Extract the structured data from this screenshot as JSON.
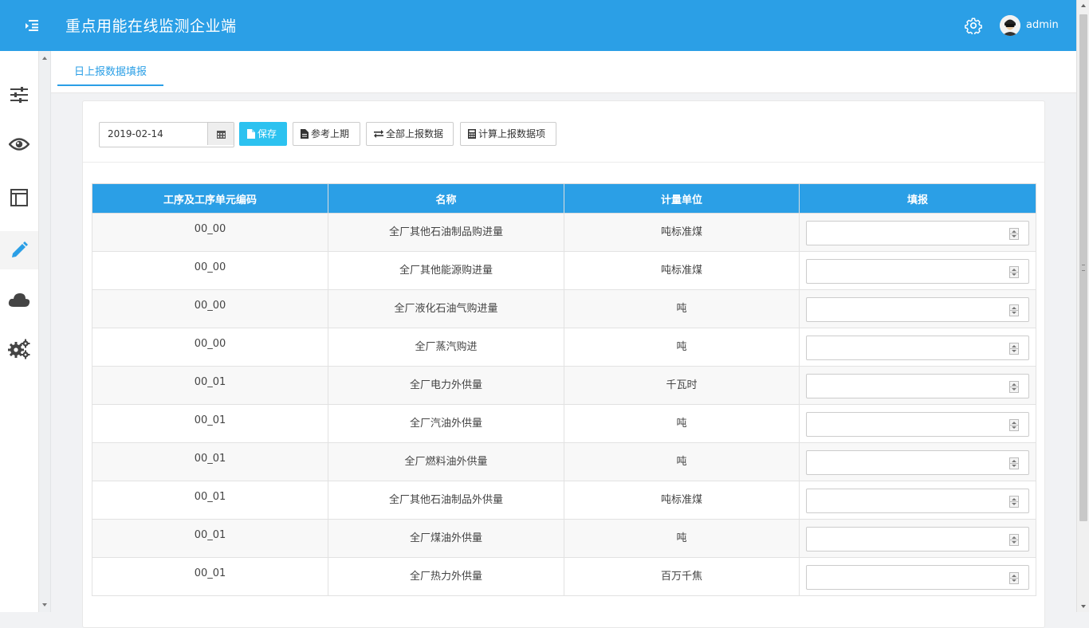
{
  "header": {
    "app_title": "重点用能在线监测企业端",
    "user_name": "admin"
  },
  "sidebar": {
    "items": [
      {
        "icon": "sliders-icon"
      },
      {
        "icon": "eye-icon"
      },
      {
        "icon": "layout-icon"
      },
      {
        "icon": "pencil-icon",
        "active": true
      },
      {
        "icon": "cloud-icon"
      },
      {
        "icon": "gears-icon"
      }
    ]
  },
  "tabs": [
    {
      "label": "日上报数据填报",
      "active": true
    }
  ],
  "toolbar": {
    "date_value": "2019-02-14",
    "save_label": "保存",
    "reference_label": "参考上期",
    "upload_all_label": "全部上报数据",
    "calculate_label": "计算上报数据项"
  },
  "table": {
    "headers": [
      "工序及工序单元编码",
      "名称",
      "计量单位",
      "填报"
    ],
    "rows": [
      {
        "code": "00_00",
        "name": "全厂其他石油制品购进量",
        "unit": "吨标准煤",
        "value": ""
      },
      {
        "code": "00_00",
        "name": "全厂其他能源购进量",
        "unit": "吨标准煤",
        "value": ""
      },
      {
        "code": "00_00",
        "name": "全厂液化石油气购进量",
        "unit": "吨",
        "value": ""
      },
      {
        "code": "00_00",
        "name": "全厂蒸汽购进",
        "unit": "吨",
        "value": ""
      },
      {
        "code": "00_01",
        "name": "全厂电力外供量",
        "unit": "千瓦时",
        "value": ""
      },
      {
        "code": "00_01",
        "name": "全厂汽油外供量",
        "unit": "吨",
        "value": ""
      },
      {
        "code": "00_01",
        "name": "全厂燃料油外供量",
        "unit": "吨",
        "value": ""
      },
      {
        "code": "00_01",
        "name": "全厂其他石油制品外供量",
        "unit": "吨标准煤",
        "value": ""
      },
      {
        "code": "00_01",
        "name": "全厂煤油外供量",
        "unit": "吨",
        "value": ""
      },
      {
        "code": "00_01",
        "name": "全厂热力外供量",
        "unit": "百万千焦",
        "value": ""
      }
    ]
  },
  "colors": {
    "header_bg": "#2b9fe6",
    "primary_button": "#2cc2f0",
    "table_header_bg": "#2b9fe6"
  }
}
